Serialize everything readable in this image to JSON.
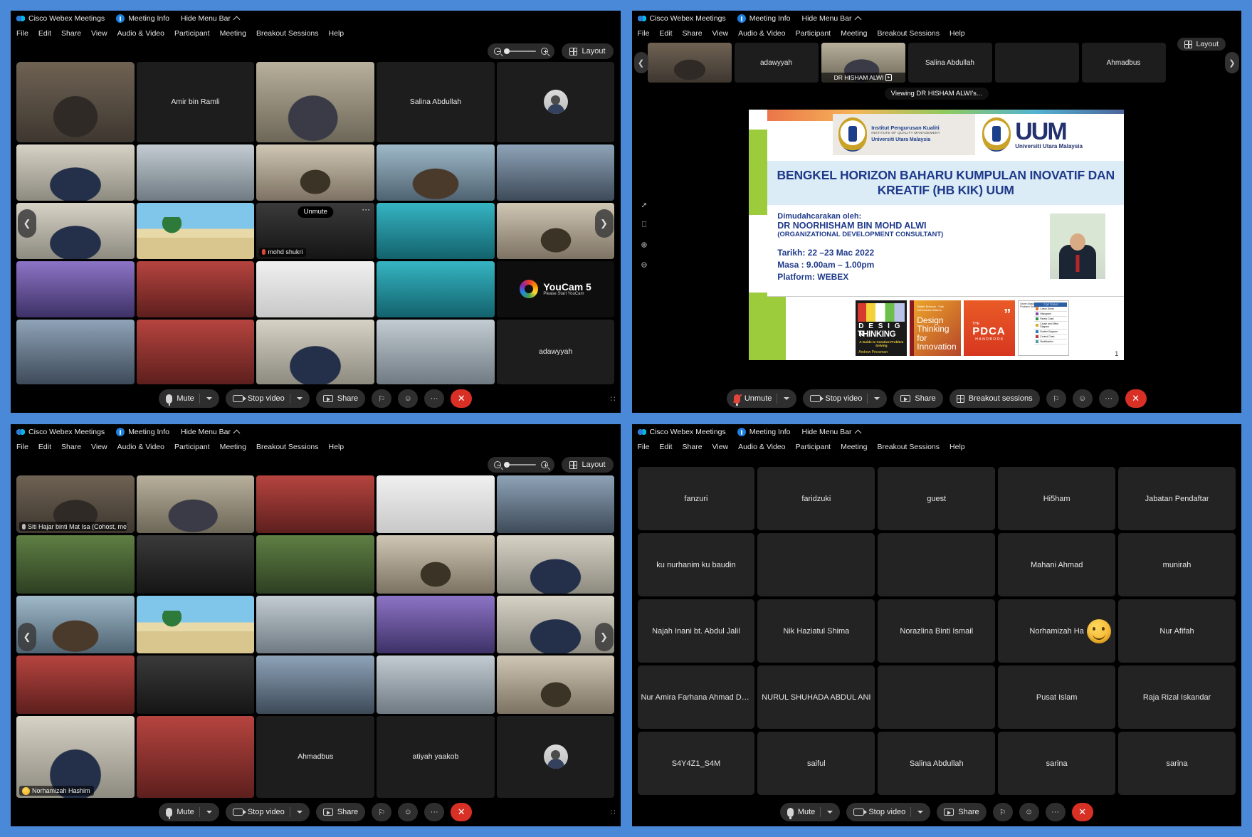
{
  "app": {
    "product": "Cisco Webex Meetings",
    "meeting_info": "Meeting Info",
    "hide_menu_bar": "Hide Menu Bar",
    "menu": [
      "File",
      "Edit",
      "Share",
      "View",
      "Audio & Video",
      "Participant",
      "Meeting",
      "Breakout Sessions",
      "Help"
    ],
    "layout_label": "Layout",
    "accent_blue": "#4a88d8",
    "end_red": "#d93025",
    "selfview_outline": "#3e9bf2"
  },
  "toolbar": {
    "mute": "Mute",
    "unmute": "Unmute",
    "stop_video": "Stop video",
    "share": "Share",
    "breakout_sessions": "Breakout sessions",
    "more": "···",
    "reactions": "☺",
    "participants": "⚐",
    "end": "✕",
    "right_nub": "∷"
  },
  "panels": {
    "top_left": {
      "name": "grid-view-meeting",
      "tiles": [
        {
          "name": "",
          "style": "ph a",
          "self": true
        },
        {
          "name": "Amir bin Ramli",
          "style": "",
          "self": false
        },
        {
          "name": "",
          "style": "ph b",
          "self": false
        },
        {
          "name": "Salina Abdullah",
          "style": "",
          "self": false
        },
        {
          "name": "",
          "style": "avatar",
          "self": false
        },
        {
          "name": "",
          "style": "ph c",
          "self": false
        },
        {
          "name": "",
          "style": "ph mask",
          "self": false
        },
        {
          "name": "",
          "style": "ph room",
          "self": false
        },
        {
          "name": "",
          "style": "ph d",
          "self": false
        },
        {
          "name": "",
          "style": "ph office",
          "self": false
        },
        {
          "name": "",
          "style": "ph c",
          "self": false
        },
        {
          "name": "",
          "style": "ph beach",
          "self": false
        },
        {
          "name": "mohd shukri",
          "style": "ph dark",
          "self": false,
          "badge": true,
          "pill": "Unmute",
          "dots": true
        },
        {
          "name": "",
          "style": "ph teal",
          "self": false
        },
        {
          "name": "",
          "style": "ph room",
          "self": false
        },
        {
          "name": "",
          "style": "ph purple",
          "self": false
        },
        {
          "name": "",
          "style": "ph red",
          "self": false
        },
        {
          "name": "",
          "style": "ph white",
          "self": false
        },
        {
          "name": "",
          "style": "ph teal",
          "self": false
        },
        {
          "name": "",
          "style": "youcam",
          "self": false
        },
        {
          "name": "",
          "style": "ph office",
          "self": false
        },
        {
          "name": "",
          "style": "ph red",
          "self": false
        },
        {
          "name": "",
          "style": "ph c",
          "self": false
        },
        {
          "name": "",
          "style": "ph mask",
          "self": false
        },
        {
          "name": "adawyyah",
          "style": "",
          "self": false
        }
      ],
      "youcam": {
        "title": "YouCam 5",
        "sub": "Please Start YouCam"
      }
    },
    "top_right": {
      "name": "content-share-meeting",
      "filmstrip": [
        {
          "name": "",
          "style": "ph a",
          "caption": "",
          "active": false
        },
        {
          "name": "adawyyah",
          "style": "",
          "caption": "",
          "active": false
        },
        {
          "name": "",
          "style": "ph b",
          "caption": "DR HISHAM ALWI",
          "active": true
        },
        {
          "name": "Salina Abdullah",
          "style": "",
          "caption": "",
          "active": false
        },
        {
          "name": "",
          "style": "avatar",
          "caption": "",
          "active": false
        },
        {
          "name": "Ahmadbus",
          "style": "",
          "caption": "",
          "active": false
        }
      ],
      "viewing_pill": "Viewing DR HISHAM ALWI's...",
      "slide": {
        "org_left_line1": "Institut Pengurusan Kualiti",
        "org_left_line2": "INSTITUTE OF QUALITY MANAGEMENT",
        "org_left_line3": "Universiti Utara Malaysia",
        "uum_acronym": "UUM",
        "uum_sub": "Universiti Utara Malaysia",
        "title": "BENGKEL HORIZON BAHARU KUMPULAN INOVATIF DAN KREATIF (HB KIK) UUM",
        "facilitator_label": "Dimudahcarakan oleh:",
        "facilitator_name": "DR NOORHISHAM BIN MOHD ALWI",
        "facilitator_role": "(ORGANIZATIONAL DEVELOPMENT CONSULTANT)",
        "date": "Tarikh: 22 –23 Mac 2022",
        "time": "Masa : 9.00am – 1.00pm",
        "platform": "Platform: WEBEX",
        "page_number": "1",
        "books": [
          {
            "title_1": "D E S I G N",
            "title_2": "THINKING",
            "sub": "A Guide to Creative Problem Solving",
            "author": "Andrew Pressman"
          },
          {
            "authors": "Walter Brenner · Falk Uebernickel Editors",
            "title": "Design Thinking for Innovation"
          },
          {
            "the": "THE",
            "name": "PDCA",
            "kind": "HANDBOOK"
          },
          {
            "heading": "Seven Basic Quality Tools of Problem Solving",
            "table_title": "7 QC TOOLS",
            "rows": [
              "Check Sheet",
              "Histogram",
              "Pareto Chart",
              "Cause and Effect Diagram",
              "Scatter Diagram",
              "Control Chart",
              "Stratification"
            ]
          }
        ]
      }
    },
    "bottom_left": {
      "name": "grid-view-meeting-2",
      "self_label": "Siti Hajar binti Mat Isa (Cohost, me)",
      "tiles": [
        {
          "name": "",
          "style": "ph a",
          "self": true,
          "badge": "Siti Hajar binti Mat Isa (Cohost, me)"
        },
        {
          "name": "",
          "style": "ph b",
          "self": false
        },
        {
          "name": "",
          "style": "ph red",
          "self": false
        },
        {
          "name": "",
          "style": "ph white",
          "self": false
        },
        {
          "name": "",
          "style": "ph office",
          "self": false
        },
        {
          "name": "",
          "style": "ph green",
          "self": false
        },
        {
          "name": "",
          "style": "ph dark",
          "self": false
        },
        {
          "name": "",
          "style": "ph green",
          "self": false
        },
        {
          "name": "",
          "style": "ph room",
          "self": false
        },
        {
          "name": "",
          "style": "ph c",
          "self": false
        },
        {
          "name": "",
          "style": "ph d",
          "self": false
        },
        {
          "name": "",
          "style": "ph beach",
          "self": false
        },
        {
          "name": "",
          "style": "ph mask",
          "self": false
        },
        {
          "name": "",
          "style": "ph purple",
          "self": false
        },
        {
          "name": "",
          "style": "ph c",
          "self": false
        },
        {
          "name": "",
          "style": "ph red",
          "self": false
        },
        {
          "name": "",
          "style": "ph dark",
          "self": false
        },
        {
          "name": "",
          "style": "ph office",
          "self": false
        },
        {
          "name": "",
          "style": "ph mask",
          "self": false
        },
        {
          "name": "",
          "style": "ph room",
          "self": false
        },
        {
          "name": "",
          "style": "ph c",
          "self": false,
          "badge": "Norhamizah Hashim",
          "emoji": true
        },
        {
          "name": "",
          "style": "ph red",
          "self": false
        },
        {
          "name": "Ahmadbus",
          "style": "",
          "self": false
        },
        {
          "name": "atiyah yaakob",
          "style": "",
          "self": false
        },
        {
          "name": "",
          "style": "avatar",
          "self": false
        }
      ]
    },
    "bottom_right": {
      "name": "participants-name-grid",
      "tiles": [
        {
          "name": "fanzuri",
          "avatar": null
        },
        {
          "name": "faridzuki",
          "avatar": null
        },
        {
          "name": "guest",
          "avatar": null
        },
        {
          "name": "Hi5ham",
          "avatar": null
        },
        {
          "name": "Jabatan Pendaftar",
          "avatar": null
        },
        {
          "name": "ku nurhanim ku baudin",
          "avatar": null
        },
        {
          "name": "",
          "avatar": "light"
        },
        {
          "name": "",
          "avatar": "warm"
        },
        {
          "name": "Mahani Ahmad",
          "avatar": null
        },
        {
          "name": "munirah",
          "avatar": null
        },
        {
          "name": "Najah Inani bt. Abdul Jalil",
          "avatar": null
        },
        {
          "name": "Nik Haziatul Shima",
          "avatar": null
        },
        {
          "name": "Norazlina Binti Ismail",
          "avatar": null
        },
        {
          "name": "Norhamizah Ha",
          "avatar": null,
          "emoji": true
        },
        {
          "name": "Nur Afifah",
          "avatar": null
        },
        {
          "name": "Nur Amira Farhana Ahmad Da...",
          "avatar": null
        },
        {
          "name": "NURUL SHUHADA ABDUL ANI",
          "avatar": null
        },
        {
          "name": "",
          "avatar": "light"
        },
        {
          "name": "Pusat Islam",
          "avatar": null
        },
        {
          "name": "Raja Rizal Iskandar",
          "avatar": null
        },
        {
          "name": "S4Y4Z1_S4M",
          "avatar": null
        },
        {
          "name": "saiful",
          "avatar": null
        },
        {
          "name": "Salina Abdullah",
          "avatar": null
        },
        {
          "name": "sarina",
          "avatar": null
        },
        {
          "name": "sarina",
          "avatar": null
        }
      ]
    }
  }
}
